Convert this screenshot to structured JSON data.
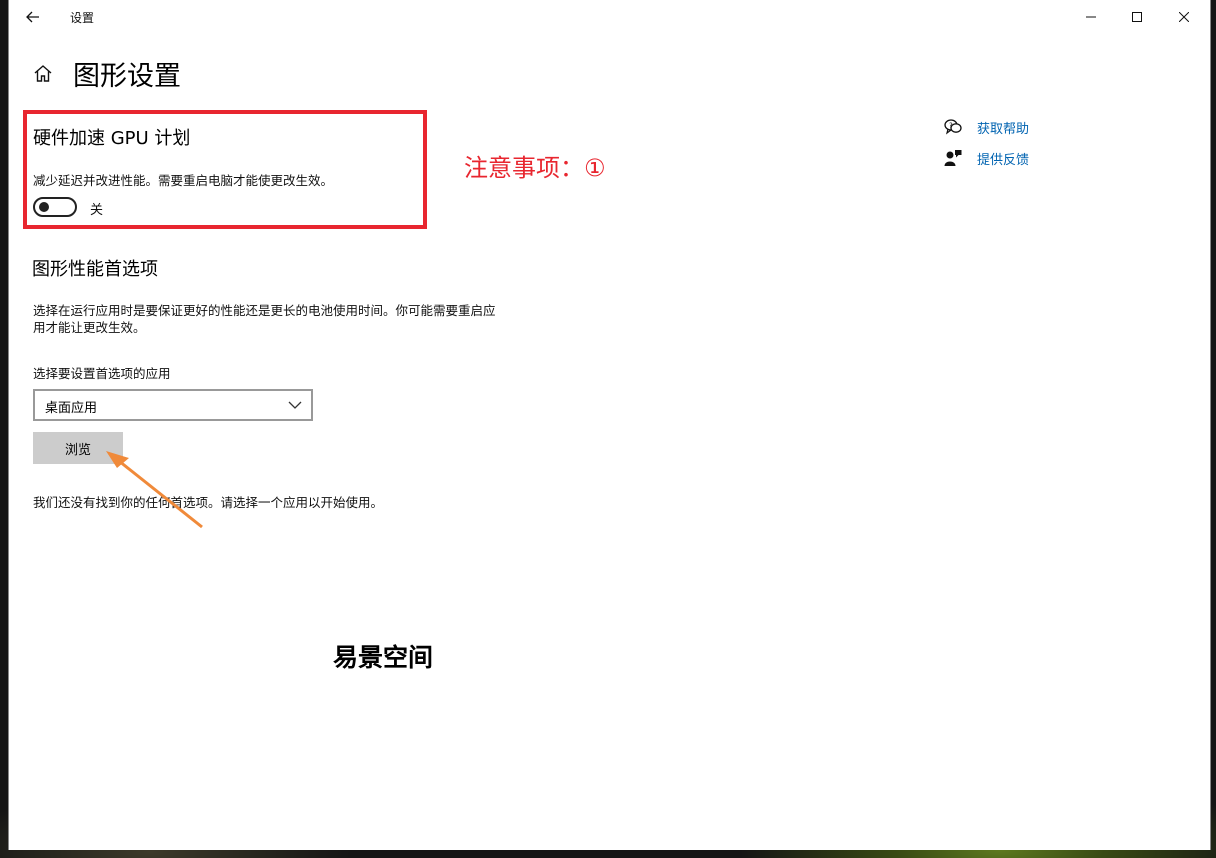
{
  "window": {
    "title": "设置"
  },
  "page": {
    "title": "图形设置"
  },
  "gpu": {
    "title": "硬件加速 GPU 计划",
    "description": "减少延迟并改进性能。需要重启电脑才能使更改生效。",
    "toggle_state_label": "关",
    "toggle_on": false
  },
  "annotation": {
    "text": "注意事项：①",
    "color": "#e8262f"
  },
  "help_links": [
    {
      "label": "获取帮助",
      "icon": "help-chat-icon"
    },
    {
      "label": "提供反馈",
      "icon": "feedback-icon"
    }
  ],
  "performance": {
    "title": "图形性能首选项",
    "description": "选择在运行应用时是要保证更好的性能还是更长的电池使用时间。你可能需要重启应用才能让更改生效。",
    "select_label": "选择要设置首选项的应用",
    "select_value": "桌面应用",
    "browse_label": "浏览",
    "empty_message": "我们还没有找到你的任何首选项。请选择一个应用以开始使用。"
  },
  "watermark": {
    "text": "易景空间"
  },
  "colors": {
    "accent_link": "#0063b1",
    "highlight_border": "#e8262f",
    "arrow": "#f08a3a"
  }
}
